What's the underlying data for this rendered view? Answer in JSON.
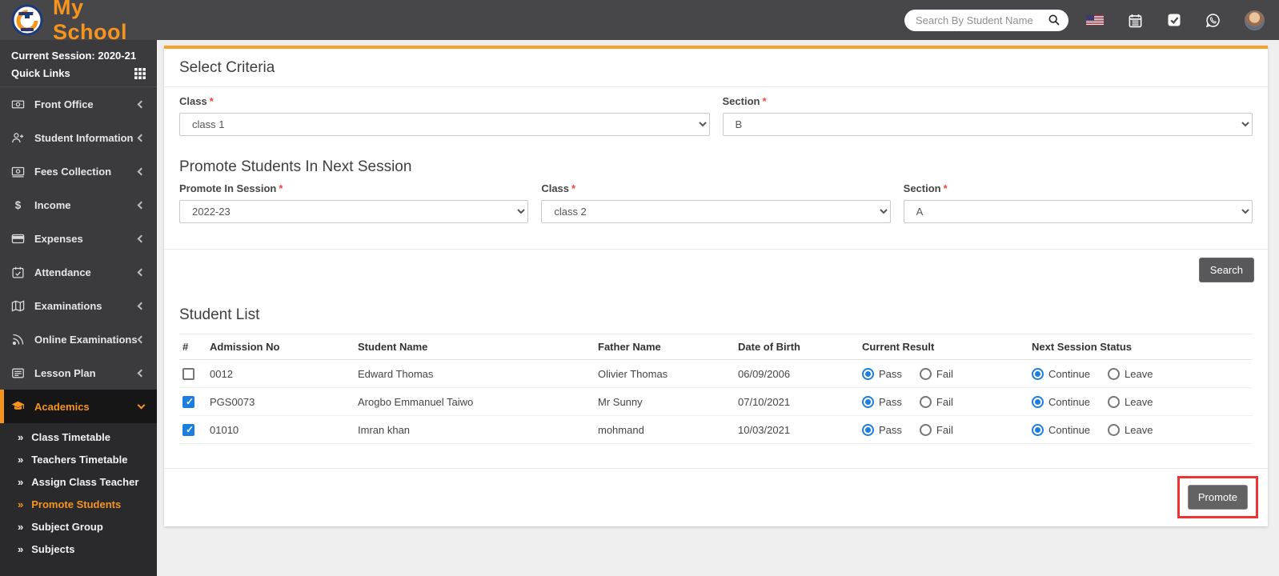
{
  "header": {
    "brand": "My School",
    "search_placeholder": "Search By Student Name",
    "icons": [
      "school-logo-icon",
      "search-icon",
      "us-flag-icon",
      "calendar-icon",
      "tasks-icon",
      "whatsapp-icon",
      "avatar"
    ]
  },
  "sidebar": {
    "session_label": "Current Session: 2020-21",
    "quick_links_label": "Quick Links",
    "items": [
      {
        "label": "Front Office",
        "icon": "cash-icon",
        "active": false
      },
      {
        "label": "Student Information",
        "icon": "person-add-icon",
        "active": false
      },
      {
        "label": "Fees Collection",
        "icon": "banknote-icon",
        "active": false
      },
      {
        "label": "Income",
        "icon": "dollar-icon",
        "active": false
      },
      {
        "label": "Expenses",
        "icon": "credit-card-icon",
        "active": false
      },
      {
        "label": "Attendance",
        "icon": "calendar-check-icon",
        "active": false
      },
      {
        "label": "Examinations",
        "icon": "map-icon",
        "active": false
      },
      {
        "label": "Online Examinations",
        "icon": "rss-icon",
        "active": false
      },
      {
        "label": "Lesson Plan",
        "icon": "card-lines-icon",
        "active": false
      },
      {
        "label": "Academics",
        "icon": "graduation-cap-icon",
        "active": true
      }
    ],
    "submenu": [
      {
        "label": "Class Timetable",
        "active": false
      },
      {
        "label": "Teachers Timetable",
        "active": false
      },
      {
        "label": "Assign Class Teacher",
        "active": false
      },
      {
        "label": "Promote Students",
        "active": true
      },
      {
        "label": "Subject Group",
        "active": false
      },
      {
        "label": "Subjects",
        "active": false
      }
    ]
  },
  "criteria": {
    "title": "Select Criteria",
    "class_label": "Class",
    "class_value": "class 1",
    "section_label": "Section",
    "section_value": "B"
  },
  "promote_section": {
    "title": "Promote Students In Next Session",
    "session_label": "Promote In Session",
    "session_value": "2022-23",
    "class_label": "Class",
    "class_value": "class 2",
    "section_label": "Section",
    "section_value": "A",
    "search_button": "Search"
  },
  "student_list": {
    "title": "Student List",
    "columns": [
      "#",
      "Admission No",
      "Student Name",
      "Father Name",
      "Date of Birth",
      "Current Result",
      "Next Session Status"
    ],
    "result_options": [
      "Pass",
      "Fail"
    ],
    "status_options": [
      "Continue",
      "Leave"
    ],
    "rows": [
      {
        "checked": false,
        "admission_no": "0012",
        "student_name": "Edward Thomas",
        "father_name": "Olivier Thomas",
        "dob": "06/09/2006",
        "current_result": "Pass",
        "next_session_status": "Continue"
      },
      {
        "checked": true,
        "admission_no": "PGS0073",
        "student_name": "Arogbo Emmanuel Taiwo",
        "father_name": "Mr Sunny",
        "dob": "07/10/2021",
        "current_result": "Pass",
        "next_session_status": "Continue"
      },
      {
        "checked": true,
        "admission_no": "01010",
        "student_name": "Imran khan",
        "father_name": "mohmand",
        "dob": "10/03/2021",
        "current_result": "Pass",
        "next_session_status": "Continue"
      }
    ],
    "promote_button": "Promote"
  },
  "colors": {
    "accent_orange": "#f7941e",
    "radio_blue": "#1c7fe0",
    "annotation_red": "#ee3333",
    "header_bg": "#47474a",
    "sidebar_bg": "#3b3b3d"
  }
}
